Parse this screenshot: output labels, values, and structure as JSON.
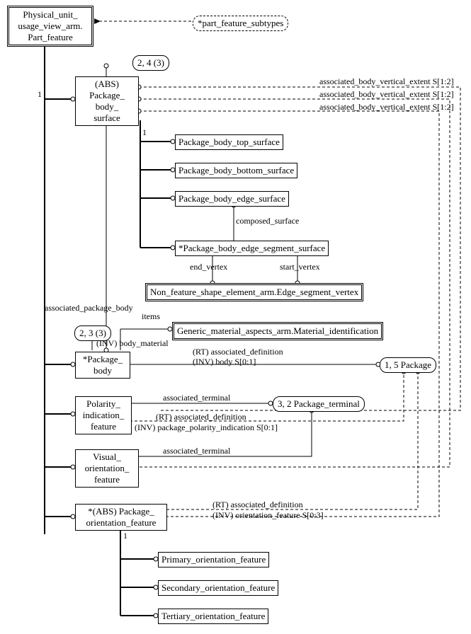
{
  "boxes": {
    "part_feature": "Physical_unit_\nusage_view_arm.\nPart_feature",
    "part_feature_subtypes": "*part_feature_subtypes",
    "pkg_body_surface": "(ABS)\nPackage_\nbody_\nsurface",
    "pkg_body_top": "Package_body_top_surface",
    "pkg_body_bottom": "Package_body_bottom_surface",
    "pkg_body_edge": "Package_body_edge_surface",
    "pkg_body_edge_seg": "*Package_body_edge_segment_surface",
    "edge_seg_vertex": "Non_feature_shape_element_arm.Edge_segment_vertex",
    "material_id": "Generic_material_aspects_arm.Material_identification",
    "pkg_body": "*Package_\nbody",
    "polarity": "Polarity_\nindication_\nfeature",
    "visual": "Visual_\norientation_\nfeature",
    "pkg_orient": "*(ABS) Package_\norientation_feature",
    "primary": "Primary_orientation_feature",
    "secondary": "Secondary_orientation_feature",
    "tertiary": "Tertiary_orientation_feature",
    "pkg_terminal": "3, 2 Package_terminal",
    "package": "1, 5 Package"
  },
  "labels": {
    "page_constraint_24": "2, 4 (3)",
    "page_constraint_23": "2, 3 (3)",
    "one_a": "1",
    "one_b": "1",
    "one_c": "1",
    "assoc_body_vert_1": "associated_body_vertical_extent S[1:2]",
    "assoc_body_vert_2": "associated_body_vertical_extent S[1:2]",
    "assoc_body_vert_3": "associated_body_vertical_extent S[1:2]",
    "composed_surface": "composed_surface",
    "end_vertex": "end_vertex",
    "start_vertex": "start_vertex",
    "assoc_pkg_body": "associated_package_body",
    "items": "items",
    "inv_body_material": "(INV) body_material",
    "rt_assoc_def_1": "(RT) associated_definition",
    "inv_body": "(INV) body S[0:1]",
    "assoc_terminal_1": "associated_terminal",
    "rt_assoc_def_2": "(RT) associated_definition",
    "inv_pkg_polarity": "(INV) package_polarity_indication S[0:1]",
    "assoc_terminal_2": "associated_terminal",
    "rt_assoc_def_3": "(RT) associated_definition",
    "inv_orient": "(INV) orientation_feature S[0:3]"
  },
  "chart_data": {
    "type": "express-g-diagram",
    "root": "Physical_unit_usage_view_arm.Part_feature",
    "subtypes_select": "*part_feature_subtypes",
    "entities": [
      {
        "name": "Package_body_surface",
        "abstract": true,
        "page": "2, 4 (3)",
        "subtypes": [
          "Package_body_top_surface",
          "Package_body_bottom_surface",
          "Package_body_edge_surface",
          "*Package_body_edge_segment_surface"
        ]
      },
      {
        "name": "Package_body_edge_segment_surface",
        "attributes": [
          {
            "name": "composed_surface",
            "target": "Package_body_edge_surface"
          },
          {
            "name": "end_vertex",
            "target": "Edge_segment_vertex"
          },
          {
            "name": "start_vertex",
            "target": "Edge_segment_vertex"
          }
        ]
      },
      {
        "name": "*Package_body",
        "page": "2, 3 (3)",
        "attributes": [
          {
            "name": "items",
            "target": "Material_identification",
            "inverse": "body_material"
          },
          {
            "name": "(RT) associated_definition",
            "target": "1, 5 Package",
            "inverse": "body S[0:1]"
          }
        ]
      },
      {
        "name": "Polarity_indication_feature",
        "attributes": [
          {
            "name": "associated_terminal",
            "target": "3, 2 Package_terminal"
          },
          {
            "name": "(RT) associated_definition",
            "target": "1, 5 Package",
            "inverse": "package_polarity_indication S[0:1]"
          },
          {
            "name": "associated_body_vertical_extent S[1:2]",
            "target": "Package_body_surface",
            "optional": true
          }
        ]
      },
      {
        "name": "Visual_orientation_feature",
        "attributes": [
          {
            "name": "associated_terminal",
            "target": "3, 2 Package_terminal"
          },
          {
            "name": "associated_body_vertical_extent S[1:2]",
            "target": "Package_body_surface",
            "optional": true
          }
        ]
      },
      {
        "name": "*(ABS) Package_orientation_feature",
        "abstract": true,
        "attributes": [
          {
            "name": "(RT) associated_definition",
            "target": "1, 5 Package",
            "inverse": "orientation_feature S[0:3]"
          },
          {
            "name": "associated_body_vertical_extent S[1:2]",
            "target": "Package_body_surface",
            "optional": true
          }
        ],
        "subtypes": [
          "Primary_orientation_feature",
          "Secondary_orientation_feature",
          "Tertiary_orientation_feature"
        ]
      },
      {
        "name": "3, 2 Package_terminal",
        "reference": true
      },
      {
        "name": "1, 5 Package",
        "reference": true
      },
      {
        "name": "Non_feature_shape_element_arm.Edge_segment_vertex",
        "reference": true
      },
      {
        "name": "Generic_material_aspects_arm.Material_identification",
        "reference": true
      }
    ],
    "associated_package_body_relation": {
      "from": "Package_body_surface",
      "to": "*Package_body",
      "label": "associated_package_body"
    }
  }
}
